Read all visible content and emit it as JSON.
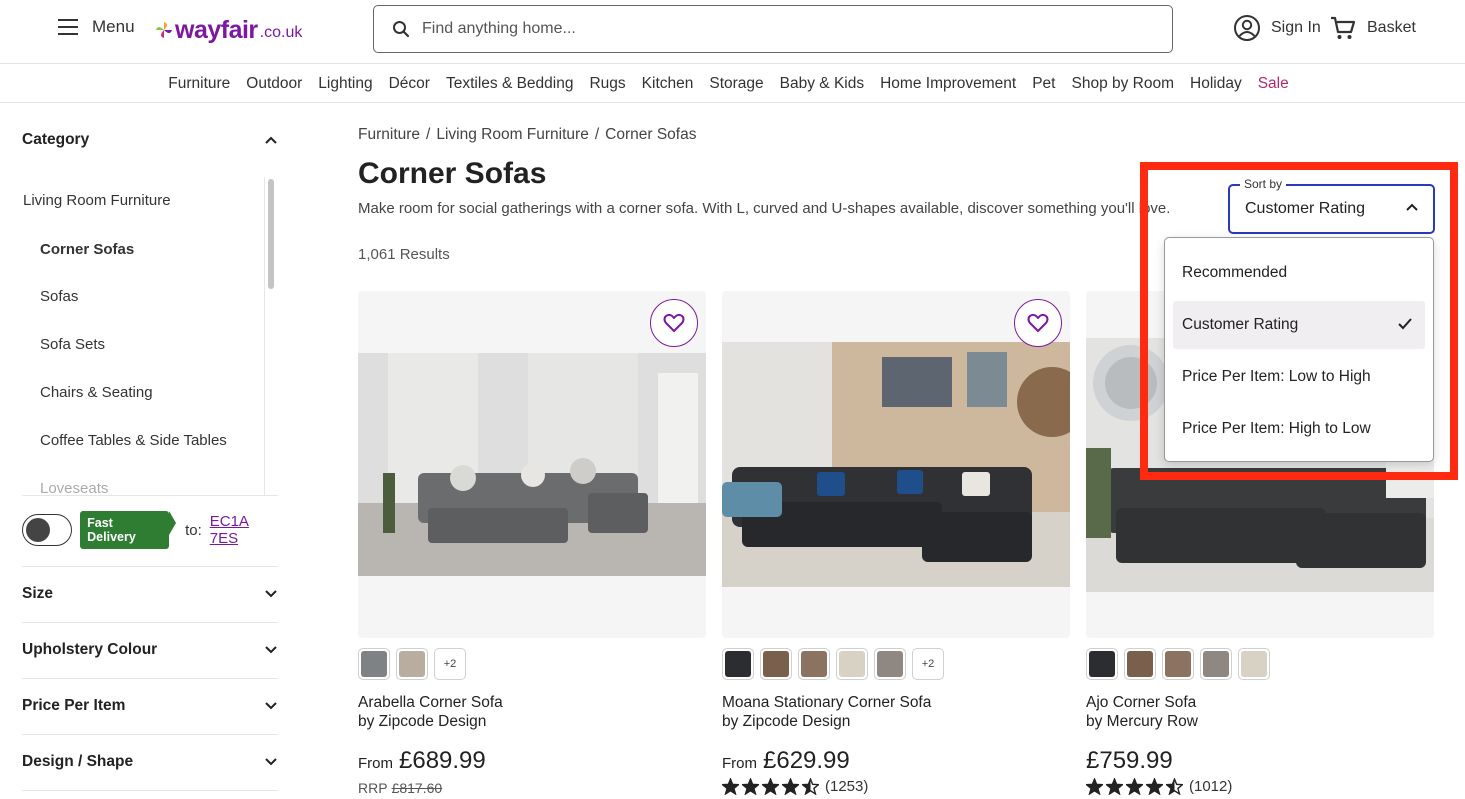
{
  "header": {
    "menu_label": "Menu",
    "logo_word": "wayfair",
    "logo_tld": ".co.uk",
    "search_placeholder": "Find anything home...",
    "signin_label": "Sign In",
    "basket_label": "Basket"
  },
  "nav": {
    "items": [
      "Furniture",
      "Outdoor",
      "Lighting",
      "Décor",
      "Textiles & Bedding",
      "Rugs",
      "Kitchen",
      "Storage",
      "Baby & Kids",
      "Home Improvement",
      "Pet",
      "Shop by Room",
      "Holiday",
      "Sale"
    ]
  },
  "sidebar": {
    "category_title": "Category",
    "parent": "Living Room Furniture",
    "items": [
      "Corner Sofas",
      "Sofas",
      "Sofa Sets",
      "Chairs & Seating",
      "Coffee Tables & Side Tables",
      "Loveseats"
    ],
    "fast_delivery_label": "Fast Delivery",
    "to_label": "to:",
    "postcode": "EC1A 7ES",
    "facets": [
      "Size",
      "Upholstery Colour",
      "Price Per Item",
      "Design / Shape"
    ]
  },
  "breadcrumb": {
    "items": [
      "Furniture",
      "Living Room Furniture",
      "Corner Sofas"
    ],
    "separator": "/"
  },
  "page": {
    "title": "Corner Sofas",
    "description": "Make room for social gatherings with a corner sofa. With L, curved and U-shapes available, discover something you'll love.",
    "results": "1,061 Results"
  },
  "sort": {
    "label": "Sort by",
    "value": "Customer Rating",
    "options": [
      "Recommended",
      "Customer Rating",
      "Price Per Item: Low to High",
      "Price Per Item: High to Low"
    ],
    "selected_index": 1
  },
  "products": [
    {
      "name": "Arabella Corner Sofa",
      "brand": "by Zipcode Design",
      "from": "From",
      "price": "£689.99",
      "rrp_label": "RRP",
      "rrp": "£817.60",
      "swatches": [
        "#7f8284",
        "#b8ad9e"
      ],
      "more": "+2"
    },
    {
      "name": "Moana Stationary Corner Sofa",
      "brand": "by Zipcode Design",
      "from": "From",
      "price": "£629.99",
      "rating": 4.5,
      "reviews": "(1253)",
      "swatches": [
        "#2b2d30",
        "#7a5f4c",
        "#8c7260",
        "#d8d2c4",
        "#8f8882"
      ],
      "more": "+2"
    },
    {
      "name": "Ajo Corner Sofa",
      "brand": "by Mercury Row",
      "price": "£759.99",
      "rating": 4.5,
      "reviews": "(1012)",
      "swatches": [
        "#2b2d30",
        "#7a5f4c",
        "#8c7260",
        "#8f8882",
        "#d8d2c4"
      ]
    }
  ],
  "colors": {
    "brand": "#7b189f",
    "sale": "#b12a6e",
    "focus": "#2a3ab8",
    "fast_delivery": "#2e7d32",
    "annotation": "#ff2a10"
  }
}
